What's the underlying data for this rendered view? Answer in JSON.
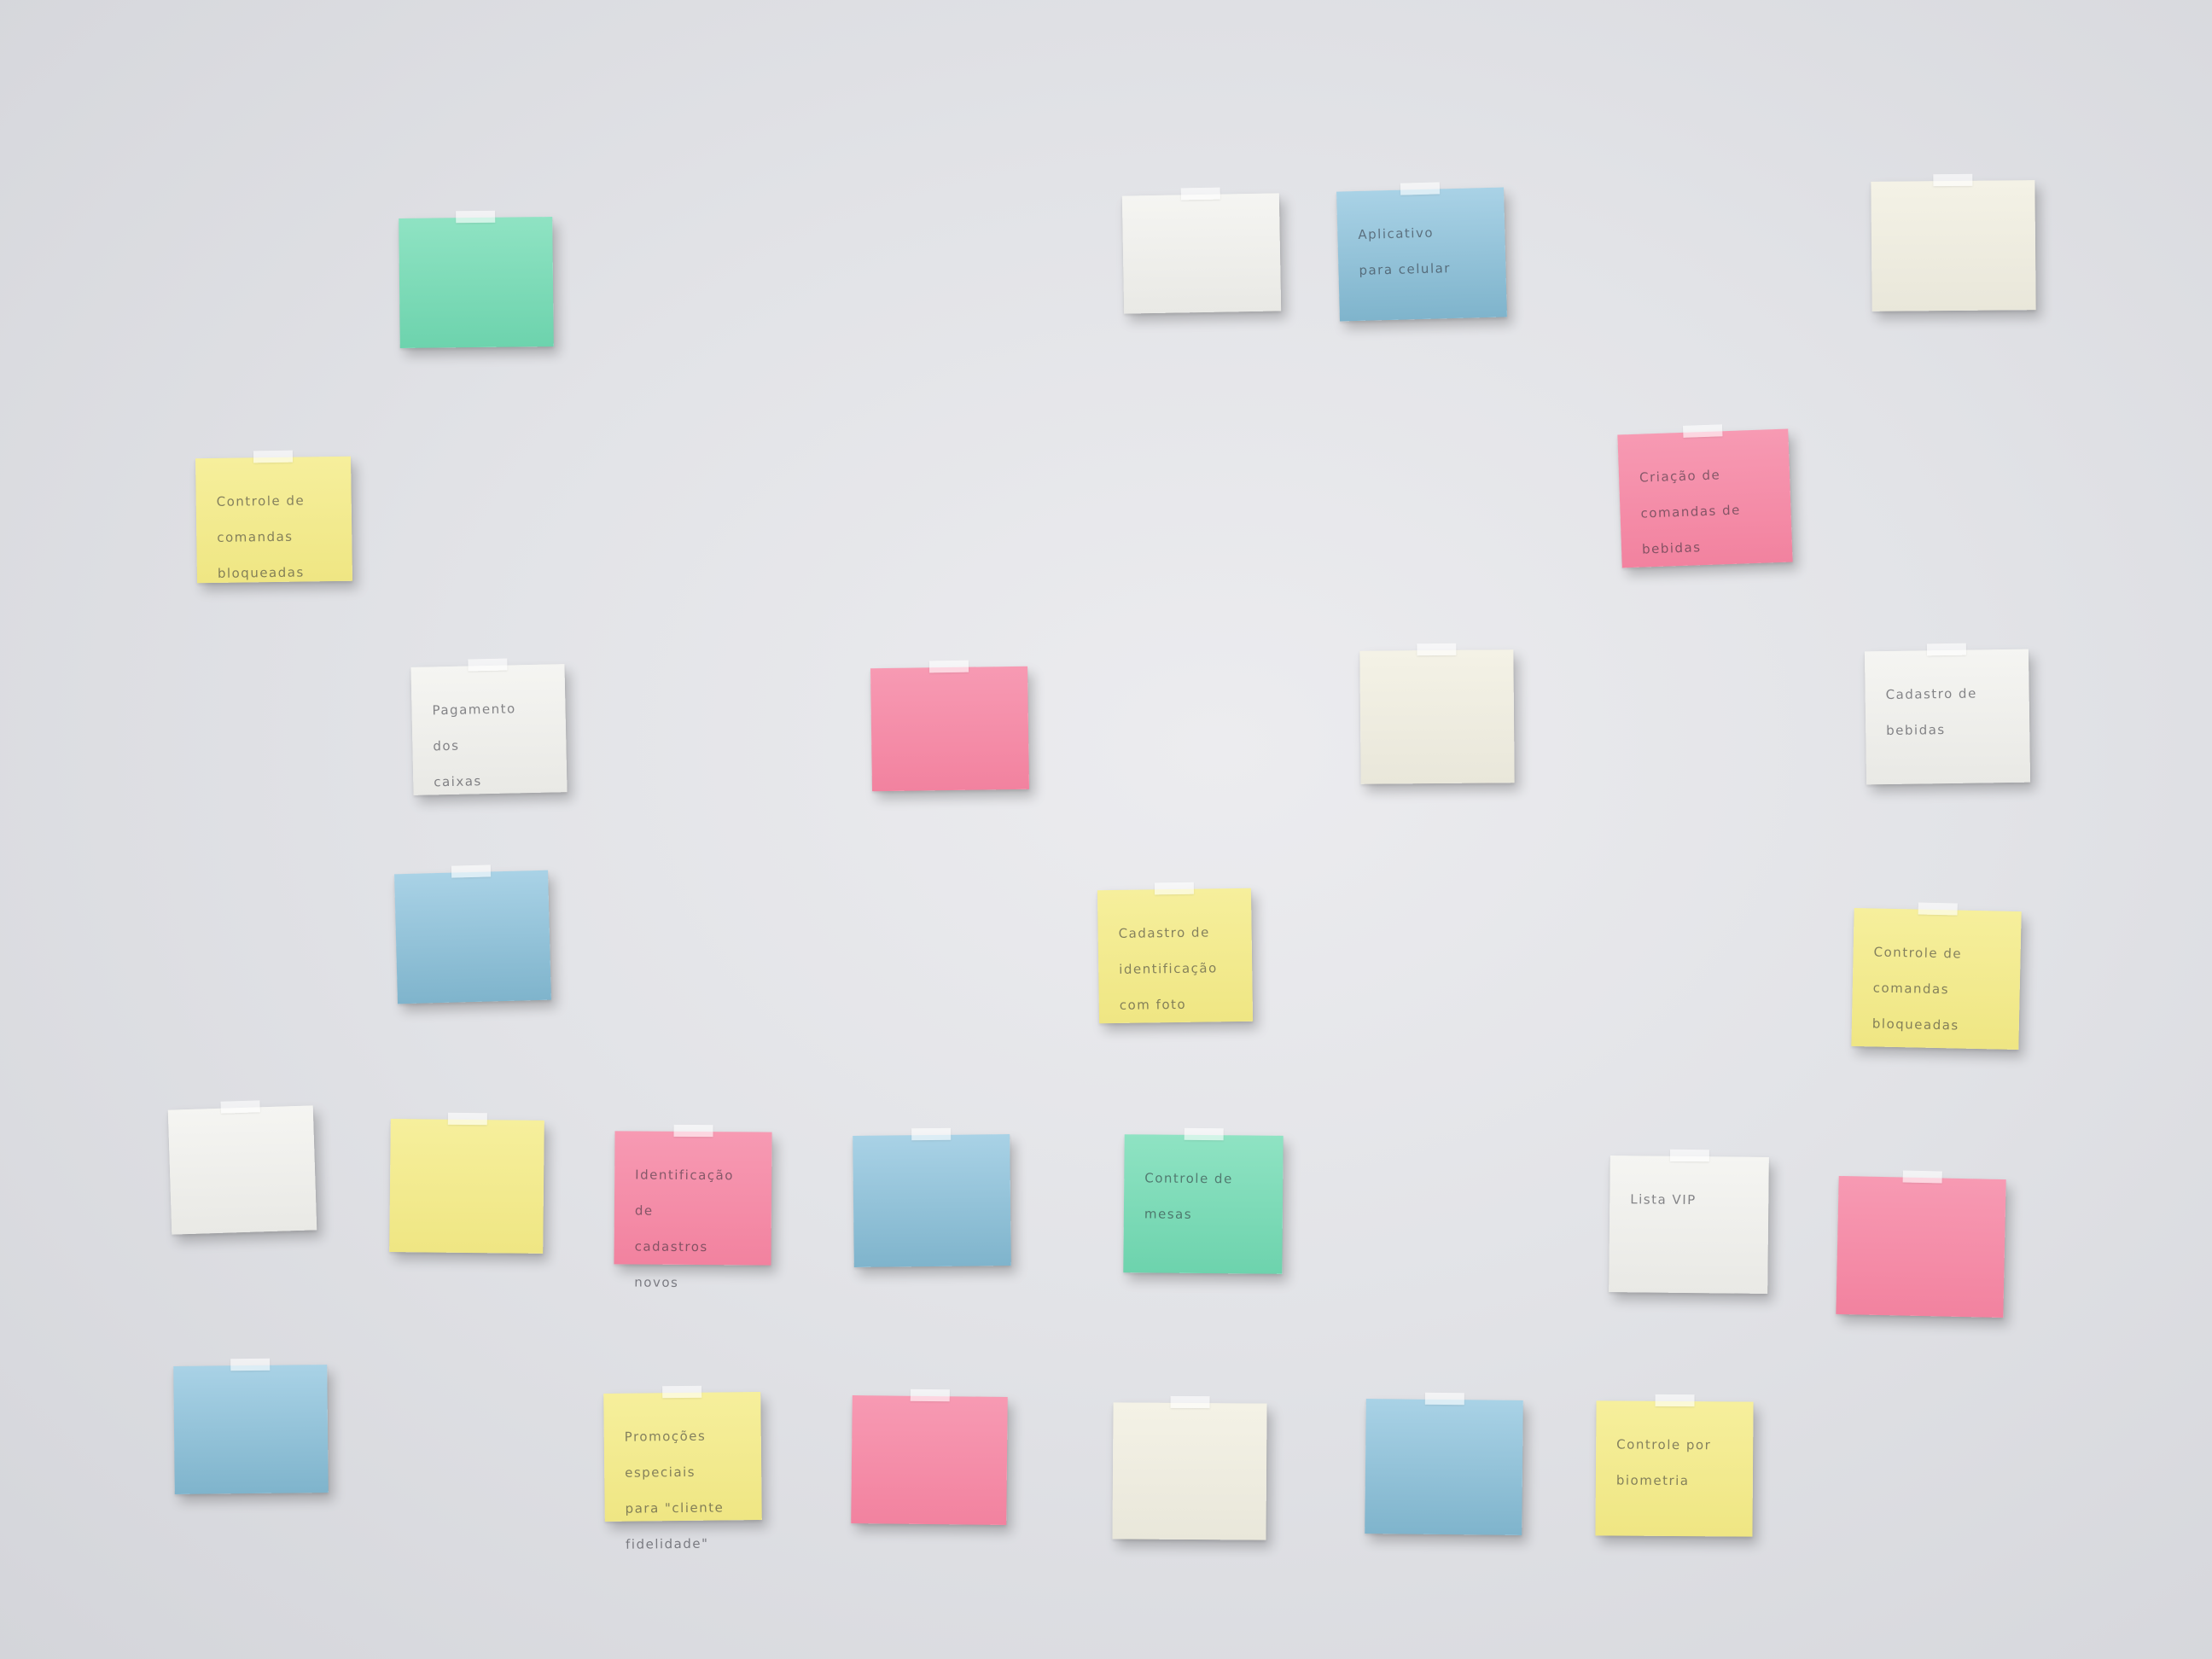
{
  "notes": [
    {
      "color": "green",
      "text": ""
    },
    {
      "color": "white",
      "text": ""
    },
    {
      "color": "blue",
      "text": "Aplicativo\npara celular"
    },
    {
      "color": "cream",
      "text": ""
    },
    {
      "color": "yellow",
      "text": "Controle de\ncomandas\nbloqueadas"
    },
    {
      "color": "pink",
      "text": "Criação de\ncomandas de bebidas"
    },
    {
      "color": "white",
      "text": "Pagamento dos\ncaixas"
    },
    {
      "color": "pink",
      "text": ""
    },
    {
      "color": "cream",
      "text": ""
    },
    {
      "color": "white",
      "text": "Cadastro de\nbebidas"
    },
    {
      "color": "blue",
      "text": ""
    },
    {
      "color": "yellow",
      "text": "Cadastro de\nidentificação\ncom foto"
    },
    {
      "color": "yellow",
      "text": "Controle de\ncomandas bloqueadas"
    },
    {
      "color": "white",
      "text": ""
    },
    {
      "color": "yellow",
      "text": ""
    },
    {
      "color": "pink",
      "text": "Identificação de\ncadastros\nnovos"
    },
    {
      "color": "blue",
      "text": ""
    },
    {
      "color": "green",
      "text": "Controle de\nmesas"
    },
    {
      "color": "white",
      "text": "Lista VIP"
    },
    {
      "color": "pink",
      "text": ""
    },
    {
      "color": "blue",
      "text": ""
    },
    {
      "color": "yellow",
      "text": "Promoções especiais\npara \"cliente fidelidade\""
    },
    {
      "color": "pink",
      "text": ""
    },
    {
      "color": "cream",
      "text": ""
    },
    {
      "color": "blue",
      "text": ""
    },
    {
      "color": "yellow",
      "text": "Controle por\nbiometria"
    }
  ]
}
